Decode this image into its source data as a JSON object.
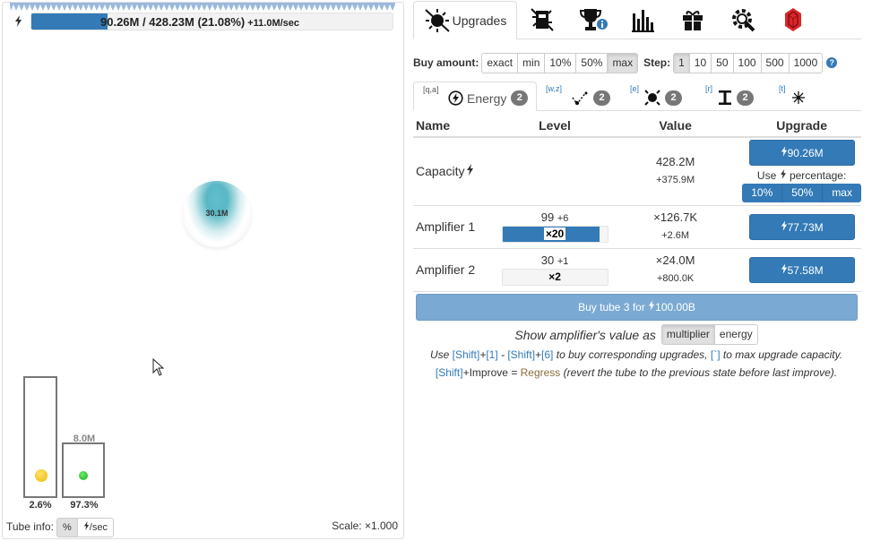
{
  "left_panel": {
    "energy": {
      "current": "90.26M",
      "separator": "/",
      "capacity": "428.23M",
      "percent_text": "(21.08%)",
      "rate": "+11.0M/sec",
      "fill_fraction": 0.2108
    },
    "bubble_label": "30.1M",
    "tubes": [
      {
        "percent": "2.6%",
        "ball_color": "#f0c419"
      },
      {
        "percent": "97.3%",
        "capacity_label": "8.0M",
        "ball_color": "#22c022"
      }
    ],
    "tube_info": {
      "label": "Tube info:",
      "options": [
        "%",
        "/sec"
      ],
      "selected": "%"
    },
    "scale": "Scale: ×1.000"
  },
  "right_panel": {
    "main_tabs": [
      {
        "label": "Upgrades",
        "icon": "upgrades-icon",
        "active": true
      },
      {
        "icon": "tubes-icon"
      },
      {
        "icon": "trophy-icon"
      },
      {
        "icon": "stats-icon"
      },
      {
        "icon": "gift-icon"
      },
      {
        "icon": "settings-icon"
      },
      {
        "icon": "ruby-icon"
      }
    ],
    "buy_amount": {
      "label": "Buy amount:",
      "options": [
        "exact",
        "min",
        "10%",
        "50%",
        "max"
      ],
      "selected": "max"
    },
    "step": {
      "label": "Step:",
      "options": [
        "1",
        "10",
        "50",
        "100",
        "500",
        "1000"
      ],
      "selected": "1"
    },
    "sub_tabs": [
      {
        "key": "[q,a]",
        "name": "Energy",
        "icon": "bolt-circle-icon",
        "badge": "2",
        "active": true
      },
      {
        "key": "[w,z]",
        "icon": "checkmark-dots-icon",
        "badge": "2"
      },
      {
        "key": "[e]",
        "icon": "burst-icon",
        "badge": "2"
      },
      {
        "key": "[r]",
        "icon": "height-icon",
        "badge": "2"
      },
      {
        "key": "[t]",
        "icon": "sparkle-icon"
      }
    ],
    "table": {
      "headers": [
        "Name",
        "Level",
        "Value",
        "Upgrade"
      ],
      "rows": [
        {
          "name": "Capacity",
          "name_icon": "bolt-icon",
          "value": "428.2M",
          "value_sub": "+375.9M",
          "cost": "90.26M",
          "pct_label_before": "Use",
          "pct_label_after": "percentage:",
          "pct_options": [
            "10%",
            "50%",
            "max"
          ]
        },
        {
          "name": "Amplifier 1",
          "level": "99",
          "level_plus": "+6",
          "bar_label": "×20",
          "bar_fill": 0.93,
          "value": "×126.7K",
          "value_sub": "+2.6M",
          "cost": "77.73M"
        },
        {
          "name": "Amplifier 2",
          "level": "30",
          "level_plus": "+1",
          "bar_label": "×2",
          "bar_fill": 0,
          "value": "×24.0M",
          "value_sub": "+800.0K",
          "cost": "57.58M"
        }
      ]
    },
    "buy_tube": {
      "text": "Buy tube 3 for",
      "cost": "100.00B"
    },
    "show_amplifier": {
      "label": "Show amplifier's value as",
      "options": [
        "multiplier",
        "energy"
      ],
      "selected": "multiplier"
    },
    "help": {
      "line1": {
        "prefix": "Use",
        "k1": "[Shift]",
        "plus1": "+",
        "k2": "[1]",
        "dash": " - ",
        "k3": "[Shift]",
        "plus2": "+",
        "k4": "[6]",
        "mid": "to buy corresponding upgrades,",
        "k5": "[`]",
        "suffix": "to max upgrade capacity."
      },
      "line2": {
        "k1": "[Shift]",
        "k2": "+Improve",
        "eq": " = ",
        "regress": "Regress",
        "suffix": "(revert the tube to the previous state before last improve)."
      }
    },
    "colors": {
      "primary": "#337ab7",
      "disabled_primary": "#7aaad3",
      "badge": "#777777",
      "ruby": "#d9262b"
    }
  }
}
